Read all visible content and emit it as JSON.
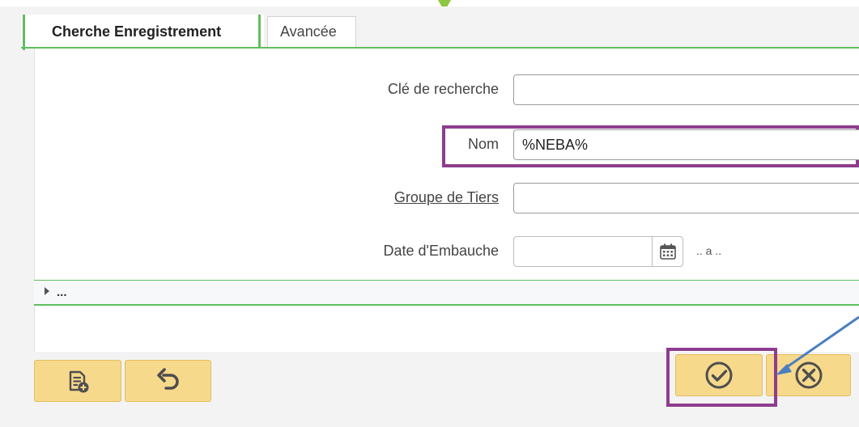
{
  "tabs": [
    {
      "label": "Cherche Enregistrement",
      "active": true
    },
    {
      "label": "Avancée",
      "active": false
    }
  ],
  "form": {
    "search_key_label": "Clé de recherche",
    "search_key_value": "",
    "name_label": "Nom",
    "name_value": "%NEBA%",
    "partner_group_label": "Groupe de Tiers",
    "partner_group_value": "",
    "hire_date_label": "Date d'Embauche",
    "hire_date_value": "",
    "range_text": ".. a .."
  },
  "advanced_section": {
    "label": "..."
  },
  "buttons": {
    "new_record": "file-add-icon",
    "reset": "undo-icon",
    "ok": "check-circle-icon",
    "cancel": "cancel-circle-icon"
  },
  "colors": {
    "accent_green": "#5fbf5f",
    "button_yellow": "#f7d98b",
    "highlight_purple": "#8e3d8e",
    "arrow_blue": "#4a7fc1"
  }
}
